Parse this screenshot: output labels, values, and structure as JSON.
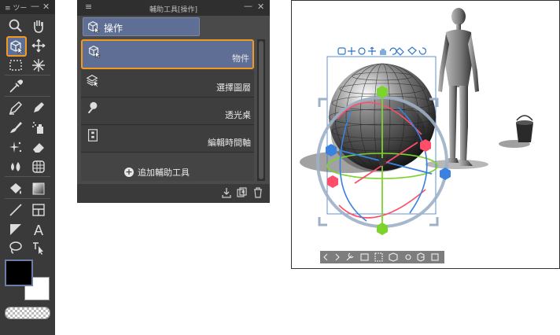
{
  "tool_palette": {
    "title": "ツー",
    "minimize": "—",
    "close": "✕",
    "tools": [
      {
        "name": "zoom-tool",
        "icon": "magnifier-icon"
      },
      {
        "name": "hand-tool",
        "icon": "hand-icon"
      },
      {
        "name": "operation-tool",
        "icon": "cube-cursor-icon",
        "selected": true
      },
      {
        "name": "move-layer-tool",
        "icon": "move-arrows-icon"
      },
      {
        "name": "selection-tool",
        "icon": "marquee-icon"
      },
      {
        "name": "auto-select-tool",
        "icon": "magic-wand-icon"
      },
      {
        "name": "eyedropper-tool",
        "icon": "eyedropper-icon"
      },
      {
        "name": "pen-tool",
        "icon": "pen-icon"
      },
      {
        "name": "pencil-tool",
        "icon": "pencil-icon"
      },
      {
        "name": "brush-tool",
        "icon": "brush-icon"
      },
      {
        "name": "airbrush-tool",
        "icon": "airbrush-icon"
      },
      {
        "name": "decoration-tool",
        "icon": "sparkle-icon"
      },
      {
        "name": "eraser-tool",
        "icon": "eraser-icon"
      },
      {
        "name": "blend-tool",
        "icon": "drops-icon"
      },
      {
        "name": "mesh-tool",
        "icon": "mesh-icon"
      },
      {
        "name": "fill-tool",
        "icon": "bucket-icon"
      },
      {
        "name": "gradient-tool",
        "icon": "gradient-icon"
      },
      {
        "name": "figure-tool",
        "icon": "line-icon"
      },
      {
        "name": "frame-border-tool",
        "icon": "frame-icon"
      },
      {
        "name": "balloon-tool",
        "icon": "triangle-icon"
      },
      {
        "name": "text-tool",
        "icon": "text-a-icon"
      },
      {
        "name": "lasso-tool",
        "icon": "lasso-icon"
      },
      {
        "name": "correct-line-tool",
        "icon": "vector-arrow-icon"
      }
    ],
    "main_color": "#000000",
    "sub_color": "#ffffff"
  },
  "sub_tool_panel": {
    "title": "輔助工具[操作]",
    "group_tab": "操作",
    "items": [
      {
        "label": "物件",
        "icon": "cube-cursor-icon",
        "active": true
      },
      {
        "label": "選擇圖層",
        "icon": "layer-select-icon",
        "active": false
      },
      {
        "label": "透光桌",
        "icon": "lightbox-icon",
        "active": false
      },
      {
        "label": "編輯時間軸",
        "icon": "timeline-icon",
        "active": false
      }
    ],
    "add_button": "追加輔助工具",
    "accent_color": "#f19a22",
    "selected_bg": "#5e6e94"
  },
  "canvas": {
    "object_toolbar_icons": [
      "camera-icon",
      "move-icon",
      "rotate-icon",
      "pan-icon",
      "hand-icon",
      "reset-icon",
      "tool-icon",
      "bucket-icon",
      "rotate-3d-icon"
    ],
    "launcher_icons": [
      "prev-icon",
      "next-icon",
      "wrench-icon",
      "camera-icon",
      "frame-icon",
      "cube-icon",
      "dot-icon",
      "settings-icon",
      "layers-icon"
    ]
  }
}
